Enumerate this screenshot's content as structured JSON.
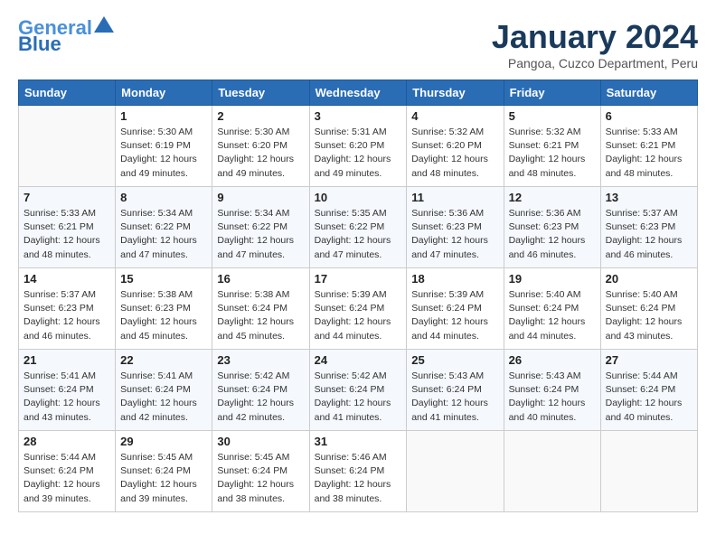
{
  "header": {
    "logo_line1": "General",
    "logo_line2": "Blue",
    "month": "January 2024",
    "location": "Pangoa, Cuzco Department, Peru"
  },
  "days_of_week": [
    "Sunday",
    "Monday",
    "Tuesday",
    "Wednesday",
    "Thursday",
    "Friday",
    "Saturday"
  ],
  "weeks": [
    [
      {
        "day": "",
        "info": ""
      },
      {
        "day": "1",
        "info": "Sunrise: 5:30 AM\nSunset: 6:19 PM\nDaylight: 12 hours\nand 49 minutes."
      },
      {
        "day": "2",
        "info": "Sunrise: 5:30 AM\nSunset: 6:20 PM\nDaylight: 12 hours\nand 49 minutes."
      },
      {
        "day": "3",
        "info": "Sunrise: 5:31 AM\nSunset: 6:20 PM\nDaylight: 12 hours\nand 49 minutes."
      },
      {
        "day": "4",
        "info": "Sunrise: 5:32 AM\nSunset: 6:20 PM\nDaylight: 12 hours\nand 48 minutes."
      },
      {
        "day": "5",
        "info": "Sunrise: 5:32 AM\nSunset: 6:21 PM\nDaylight: 12 hours\nand 48 minutes."
      },
      {
        "day": "6",
        "info": "Sunrise: 5:33 AM\nSunset: 6:21 PM\nDaylight: 12 hours\nand 48 minutes."
      }
    ],
    [
      {
        "day": "7",
        "info": "Sunrise: 5:33 AM\nSunset: 6:21 PM\nDaylight: 12 hours\nand 48 minutes."
      },
      {
        "day": "8",
        "info": "Sunrise: 5:34 AM\nSunset: 6:22 PM\nDaylight: 12 hours\nand 47 minutes."
      },
      {
        "day": "9",
        "info": "Sunrise: 5:34 AM\nSunset: 6:22 PM\nDaylight: 12 hours\nand 47 minutes."
      },
      {
        "day": "10",
        "info": "Sunrise: 5:35 AM\nSunset: 6:22 PM\nDaylight: 12 hours\nand 47 minutes."
      },
      {
        "day": "11",
        "info": "Sunrise: 5:36 AM\nSunset: 6:23 PM\nDaylight: 12 hours\nand 47 minutes."
      },
      {
        "day": "12",
        "info": "Sunrise: 5:36 AM\nSunset: 6:23 PM\nDaylight: 12 hours\nand 46 minutes."
      },
      {
        "day": "13",
        "info": "Sunrise: 5:37 AM\nSunset: 6:23 PM\nDaylight: 12 hours\nand 46 minutes."
      }
    ],
    [
      {
        "day": "14",
        "info": "Sunrise: 5:37 AM\nSunset: 6:23 PM\nDaylight: 12 hours\nand 46 minutes."
      },
      {
        "day": "15",
        "info": "Sunrise: 5:38 AM\nSunset: 6:23 PM\nDaylight: 12 hours\nand 45 minutes."
      },
      {
        "day": "16",
        "info": "Sunrise: 5:38 AM\nSunset: 6:24 PM\nDaylight: 12 hours\nand 45 minutes."
      },
      {
        "day": "17",
        "info": "Sunrise: 5:39 AM\nSunset: 6:24 PM\nDaylight: 12 hours\nand 44 minutes."
      },
      {
        "day": "18",
        "info": "Sunrise: 5:39 AM\nSunset: 6:24 PM\nDaylight: 12 hours\nand 44 minutes."
      },
      {
        "day": "19",
        "info": "Sunrise: 5:40 AM\nSunset: 6:24 PM\nDaylight: 12 hours\nand 44 minutes."
      },
      {
        "day": "20",
        "info": "Sunrise: 5:40 AM\nSunset: 6:24 PM\nDaylight: 12 hours\nand 43 minutes."
      }
    ],
    [
      {
        "day": "21",
        "info": "Sunrise: 5:41 AM\nSunset: 6:24 PM\nDaylight: 12 hours\nand 43 minutes."
      },
      {
        "day": "22",
        "info": "Sunrise: 5:41 AM\nSunset: 6:24 PM\nDaylight: 12 hours\nand 42 minutes."
      },
      {
        "day": "23",
        "info": "Sunrise: 5:42 AM\nSunset: 6:24 PM\nDaylight: 12 hours\nand 42 minutes."
      },
      {
        "day": "24",
        "info": "Sunrise: 5:42 AM\nSunset: 6:24 PM\nDaylight: 12 hours\nand 41 minutes."
      },
      {
        "day": "25",
        "info": "Sunrise: 5:43 AM\nSunset: 6:24 PM\nDaylight: 12 hours\nand 41 minutes."
      },
      {
        "day": "26",
        "info": "Sunrise: 5:43 AM\nSunset: 6:24 PM\nDaylight: 12 hours\nand 40 minutes."
      },
      {
        "day": "27",
        "info": "Sunrise: 5:44 AM\nSunset: 6:24 PM\nDaylight: 12 hours\nand 40 minutes."
      }
    ],
    [
      {
        "day": "28",
        "info": "Sunrise: 5:44 AM\nSunset: 6:24 PM\nDaylight: 12 hours\nand 39 minutes."
      },
      {
        "day": "29",
        "info": "Sunrise: 5:45 AM\nSunset: 6:24 PM\nDaylight: 12 hours\nand 39 minutes."
      },
      {
        "day": "30",
        "info": "Sunrise: 5:45 AM\nSunset: 6:24 PM\nDaylight: 12 hours\nand 38 minutes."
      },
      {
        "day": "31",
        "info": "Sunrise: 5:46 AM\nSunset: 6:24 PM\nDaylight: 12 hours\nand 38 minutes."
      },
      {
        "day": "",
        "info": ""
      },
      {
        "day": "",
        "info": ""
      },
      {
        "day": "",
        "info": ""
      }
    ]
  ]
}
